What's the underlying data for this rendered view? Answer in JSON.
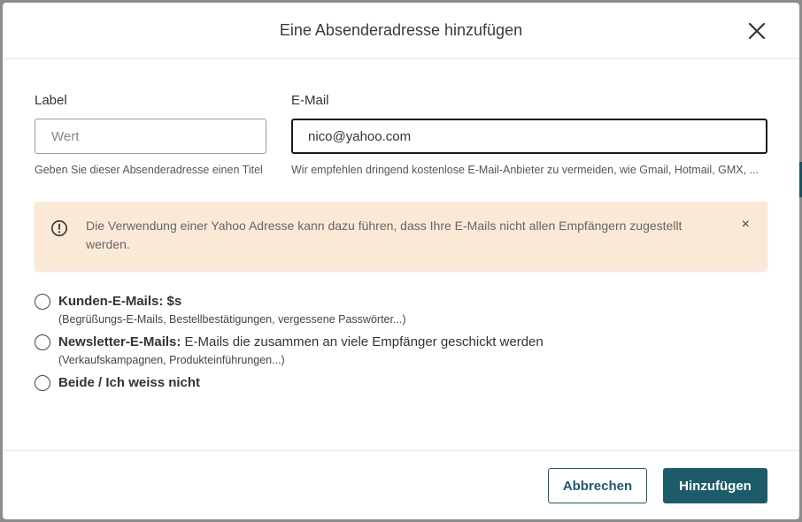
{
  "dialog": {
    "title": "Eine Absenderadresse hinzufügen"
  },
  "fields": {
    "label": {
      "label": "Label",
      "placeholder": "Wert",
      "value": "",
      "hint": "Geben Sie dieser Absenderadresse einen Titel"
    },
    "email": {
      "label": "E-Mail",
      "value": "nico@yahoo.com",
      "hint": "Wir empfehlen dringend kostenlose E-Mail-Anbieter zu vermeiden, wie Gmail, Hotmail, GMX, ..."
    }
  },
  "alert": {
    "text": "Die Verwendung einer Yahoo Adresse kann dazu führen, dass Ihre E-Mails nicht allen Empfängern zugestellt werden.",
    "close_glyph": "×",
    "icon": "exclamation-circle-icon"
  },
  "options": [
    {
      "title": "Kunden-E-Mails: $s",
      "title_rest": "",
      "desc": "(Begrüßungs-E-Mails, Bestellbestätigungen, vergessene Passwörter...)"
    },
    {
      "title": "Newsletter-E-Mails:",
      "title_rest": " E-Mails die zusammen an viele Empfänger geschickt werden",
      "desc": "(Verkaufskampagnen, Produkteinführungen...)"
    },
    {
      "title": "Beide / Ich weiss nicht",
      "title_rest": "",
      "desc": ""
    }
  ],
  "footer": {
    "cancel_label": "Abbrechen",
    "submit_label": "Hinzufügen"
  },
  "colors": {
    "primary": "#1e5b6a",
    "alert_bg": "#fbe9d8"
  }
}
